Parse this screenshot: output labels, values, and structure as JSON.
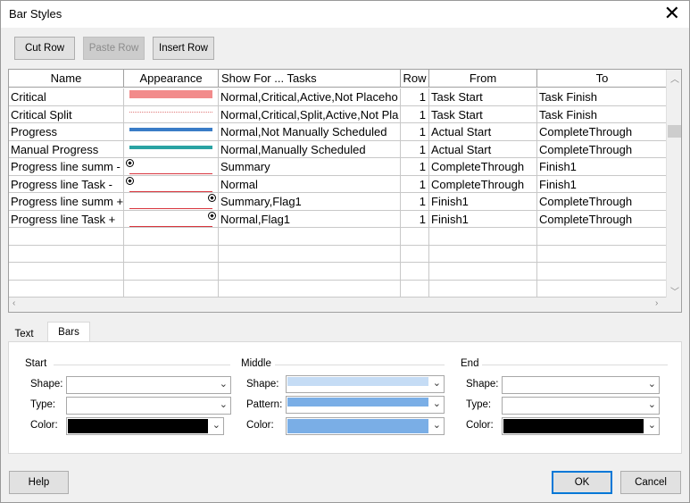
{
  "window": {
    "title": "Bar Styles",
    "close_glyph": "✕"
  },
  "toolbar": {
    "cut_row": "Cut Row",
    "paste_row": "Paste Row",
    "insert_row": "Insert Row"
  },
  "grid": {
    "headers": [
      "Name",
      "Appearance",
      "Show For ... Tasks",
      "Row",
      "From",
      "To"
    ],
    "rows": [
      {
        "name": "Critical",
        "show_for": "Normal,Critical,Active,Not Placeho",
        "row": "1",
        "from": "Task Start",
        "to": "Task Finish",
        "appearance": {
          "kind": "solid",
          "color": "#f28b8b"
        }
      },
      {
        "name": "Critical Split",
        "show_for": "Normal,Critical,Split,Active,Not Pla",
        "row": "1",
        "from": "Task Start",
        "to": "Task Finish",
        "appearance": {
          "kind": "dotted",
          "color": "#e07b7b"
        }
      },
      {
        "name": "Progress",
        "show_for": "Normal,Not Manually Scheduled",
        "row": "1",
        "from": "Actual Start",
        "to": "CompleteThrough",
        "appearance": {
          "kind": "thick",
          "color": "#3a7cc7"
        }
      },
      {
        "name": "Manual Progress",
        "show_for": "Normal,Manually Scheduled",
        "row": "1",
        "from": "Actual Start",
        "to": "CompleteThrough",
        "appearance": {
          "kind": "thick",
          "color": "#2aa3a3"
        }
      },
      {
        "name": "Progress line summ -",
        "show_for": "Summary",
        "row": "1",
        "from": "CompleteThrough",
        "to": "Finish1",
        "appearance": {
          "kind": "line-start",
          "color": "#d9363e"
        }
      },
      {
        "name": "Progress line Task -",
        "show_for": "Normal",
        "row": "1",
        "from": "CompleteThrough",
        "to": "Finish1",
        "appearance": {
          "kind": "line-start",
          "color": "#d9363e"
        }
      },
      {
        "name": "Progress line summ +",
        "show_for": "Summary,Flag1",
        "row": "1",
        "from": "Finish1",
        "to": "CompleteThrough",
        "appearance": {
          "kind": "line-end",
          "color": "#d9363e"
        }
      },
      {
        "name": "Progress line Task +",
        "show_for": "Normal,Flag1",
        "row": "1",
        "from": "Finish1",
        "to": "CompleteThrough",
        "appearance": {
          "kind": "line-end",
          "color": "#d9363e"
        }
      }
    ],
    "empty_rows": 4
  },
  "tabs": {
    "text": "Text",
    "bars": "Bars",
    "active": "Bars"
  },
  "bars": {
    "start": {
      "title": "Start",
      "shape_label": "Shape:",
      "type_label": "Type:",
      "color_label": "Color:",
      "color_value": "#000000"
    },
    "middle": {
      "title": "Middle",
      "shape_label": "Shape:",
      "pattern_label": "Pattern:",
      "color_label": "Color:",
      "shape_color": "#c5dcf5",
      "pattern_color": "#7aaee6",
      "color_value": "#7aaee6"
    },
    "end": {
      "title": "End",
      "shape_label": "Shape:",
      "type_label": "Type:",
      "color_label": "Color:",
      "color_value": "#000000"
    }
  },
  "footer": {
    "help": "Help",
    "ok": "OK",
    "cancel": "Cancel"
  }
}
